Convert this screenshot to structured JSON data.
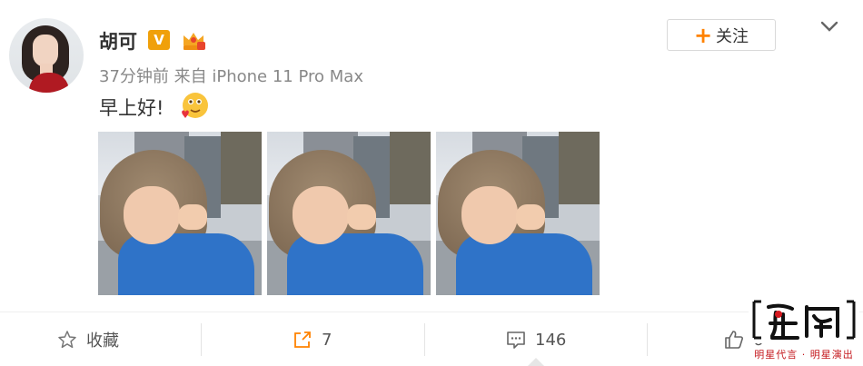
{
  "post": {
    "author": "胡可",
    "verified_badge": "V",
    "time": "37分钟前",
    "source_prefix": "来自",
    "source": "iPhone 11 Pro Max",
    "text": "早上好!",
    "follow_label": "关注"
  },
  "actions": {
    "favorite_label": "收藏",
    "repost_count": "7",
    "comment_count": "146",
    "like_count": "6"
  },
  "watermark": {
    "text": "明星代言 · 明星演出"
  },
  "colors": {
    "accent_orange": "#ff8200",
    "badge_gold": "#f0a00a",
    "watermark_red": "#c4171c"
  },
  "icons": [
    "avatar-image",
    "verified-v-icon",
    "member-crown-icon",
    "plus-icon",
    "chevron-down-icon",
    "smile-emoji-icon",
    "star-icon",
    "repost-icon",
    "comment-icon",
    "like-icon"
  ]
}
